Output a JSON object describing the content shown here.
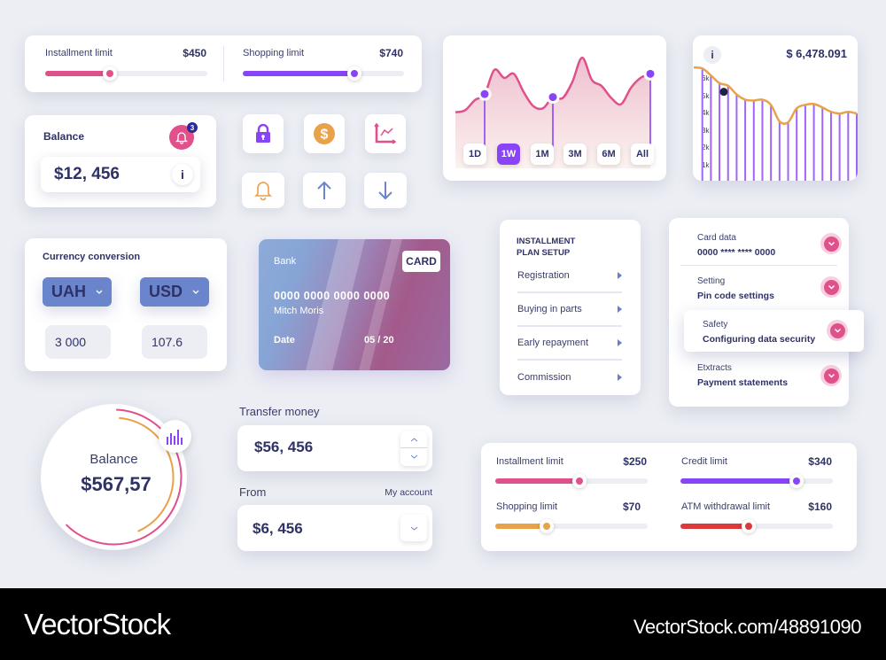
{
  "colors": {
    "background": "#eceef4",
    "navy": "#2f3266",
    "pink": "#e0508a",
    "purple": "#8a44f7",
    "orange": "#e8a24a",
    "red": "#dc3a3a",
    "blue": "#6a85cc",
    "track": "#eceef4"
  },
  "top_limits": {
    "items": [
      {
        "label": "Installment limit",
        "value": "$450",
        "fraction": 0.4,
        "color": "#e0508a"
      },
      {
        "label": "Shopping limit",
        "value": "$740",
        "fraction": 0.69,
        "color": "#8a44f7"
      }
    ]
  },
  "balance_card": {
    "title": "Balance",
    "amount": "$12, 456",
    "notification_count": "3",
    "info_icon": "i"
  },
  "icon_tiles": [
    {
      "name": "lock-icon",
      "color": "#8a44f7"
    },
    {
      "name": "dollar-coin-icon",
      "color": "#e8a24a"
    },
    {
      "name": "line-chart-icon",
      "color": "#e0508a"
    },
    {
      "name": "bell-icon",
      "color": "#e8a24a"
    },
    {
      "name": "arrow-up-icon",
      "color": "#6a85cc"
    },
    {
      "name": "arrow-down-icon",
      "color": "#6a85cc"
    }
  ],
  "area_chart": {
    "periods": [
      "1D",
      "1W",
      "1M",
      "3M",
      "6M",
      "All"
    ],
    "active_period": "1W"
  },
  "value_chart": {
    "info_icon": "i",
    "total": "$ 6,478.091",
    "y_ticks": [
      "6k",
      "5k",
      "4k",
      "3k",
      "2k",
      "1k"
    ]
  },
  "chart_data": [
    {
      "type": "area",
      "title": "",
      "x": [
        0,
        1,
        2,
        3,
        4,
        5,
        6,
        7,
        8,
        9,
        10,
        11,
        12,
        13,
        14,
        15,
        16,
        17,
        18,
        19,
        20
      ],
      "values": [
        38,
        40,
        50,
        56,
        80,
        72,
        76,
        58,
        44,
        42,
        53,
        52,
        68,
        92,
        70,
        64,
        52,
        46,
        62,
        72,
        76
      ],
      "highlighted_points": [
        3,
        10,
        20
      ],
      "ylim": [
        0,
        100
      ],
      "grid": false,
      "series_color": "#e0508a"
    },
    {
      "type": "line",
      "title": "$ 6,478.091",
      "xlabel": "",
      "ylabel": "",
      "y_tick_labels": [
        "6k",
        "5k",
        "4k",
        "3k",
        "2k",
        "1k"
      ],
      "ylim": [
        0,
        7000
      ],
      "x": [
        0,
        1,
        2,
        3,
        4,
        5,
        6,
        7,
        8,
        9,
        10,
        11,
        12,
        13,
        14,
        15,
        16,
        17,
        18,
        19
      ],
      "values": [
        6600,
        6550,
        6150,
        5700,
        5550,
        5050,
        4750,
        4700,
        4750,
        4450,
        3500,
        3450,
        4250,
        4450,
        4500,
        4300,
        4050,
        3950,
        4050,
        3950
      ],
      "highlighted_point": {
        "x": 3.5,
        "value": 5200
      },
      "bars": true,
      "line_color": "#e8a24a",
      "bar_color": "#a066f7",
      "grid": false
    }
  ],
  "currency": {
    "title": "Currency conversion",
    "from_currency": "UAH",
    "to_currency": "USD",
    "from_amount": "3 000",
    "to_amount": "107.6"
  },
  "bank_card": {
    "bank": "Bank",
    "badge": "CARD",
    "number": "0000 0000 0000 0000",
    "holder": "Mitch Moris",
    "date_label": "Date",
    "date_value": "05 / 20"
  },
  "installment_menu": {
    "title_line1": "INSTALLMENT",
    "title_line2": "PLAN SETUP",
    "items": [
      "Registration",
      "Buying in parts",
      "Early repayment",
      "Commission"
    ]
  },
  "settings_accordion": {
    "items": [
      {
        "sub": "Card data",
        "main": "0000 **** **** 0000"
      },
      {
        "sub": "Setting",
        "main": "Pin code settings"
      },
      {
        "sub": "Safety",
        "main": "Configuring data security",
        "highlighted": true
      },
      {
        "sub": "Etxtracts",
        "main": "Payment statements"
      }
    ]
  },
  "balance_circle": {
    "label": "Balance",
    "amount": "$567,57",
    "outer_ring_fraction": 0.62,
    "inner_ring_fraction": 0.42
  },
  "transfer": {
    "title": "Transfer money",
    "amount": "$56, 456",
    "from_label": "From",
    "from_account": "My account",
    "from_amount": "$6, 456"
  },
  "bottom_limits": {
    "items": [
      {
        "label": "Installment limit",
        "value": "$250",
        "fraction": 0.55,
        "color": "#e0508a"
      },
      {
        "label": "Credit limit",
        "value": "$340",
        "fraction": 0.76,
        "color": "#8a44f7"
      },
      {
        "label": "Shopping limit",
        "value": "$70",
        "fraction": 0.34,
        "color": "#e8a24a"
      },
      {
        "label": "ATM withdrawal limit",
        "value": "$160",
        "fraction": 0.45,
        "color": "#dc3a3a"
      }
    ]
  },
  "footer": {
    "brand": "VectorStock",
    "url": "VectorStock.com/48891090"
  }
}
